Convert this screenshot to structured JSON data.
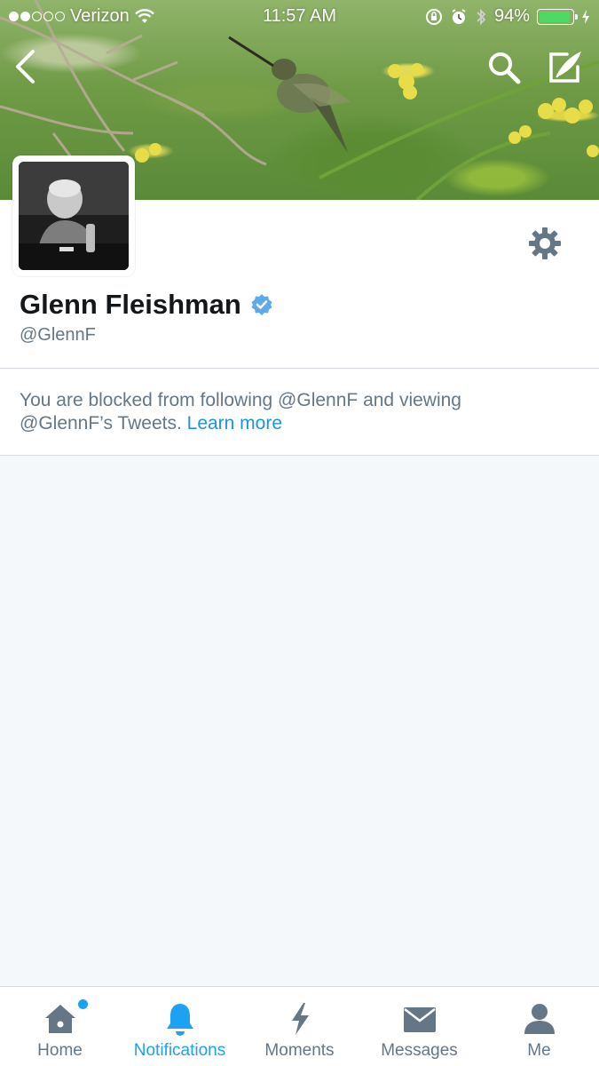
{
  "status_bar": {
    "carrier": "Verizon",
    "time": "11:57 AM",
    "battery_percent": "94%",
    "battery_level": 0.94,
    "signal_bars_filled": 2,
    "signal_bars_total": 5
  },
  "profile": {
    "display_name": "Glenn Fleishman",
    "handle": "@GlennF",
    "verified": true
  },
  "notice": {
    "text": "You are blocked from following @GlennF and viewing @GlennF’s Tweets.",
    "link_label": "Learn more"
  },
  "tabbar": {
    "tabs": [
      {
        "label": "Home",
        "icon": "home-icon",
        "active": false,
        "badge": true
      },
      {
        "label": "Notifications",
        "icon": "bell-icon",
        "active": true,
        "badge": false
      },
      {
        "label": "Moments",
        "icon": "lightning-icon",
        "active": false,
        "badge": false
      },
      {
        "label": "Messages",
        "icon": "envelope-icon",
        "active": false,
        "badge": false
      },
      {
        "label": "Me",
        "icon": "person-icon",
        "active": false,
        "badge": false
      }
    ]
  },
  "colors": {
    "accent": "#1da1f2",
    "link": "#1b95e0",
    "secondary_text": "#657786",
    "primary_text": "#14171a",
    "background": "#f5f8fa",
    "battery": "#4cd964"
  }
}
